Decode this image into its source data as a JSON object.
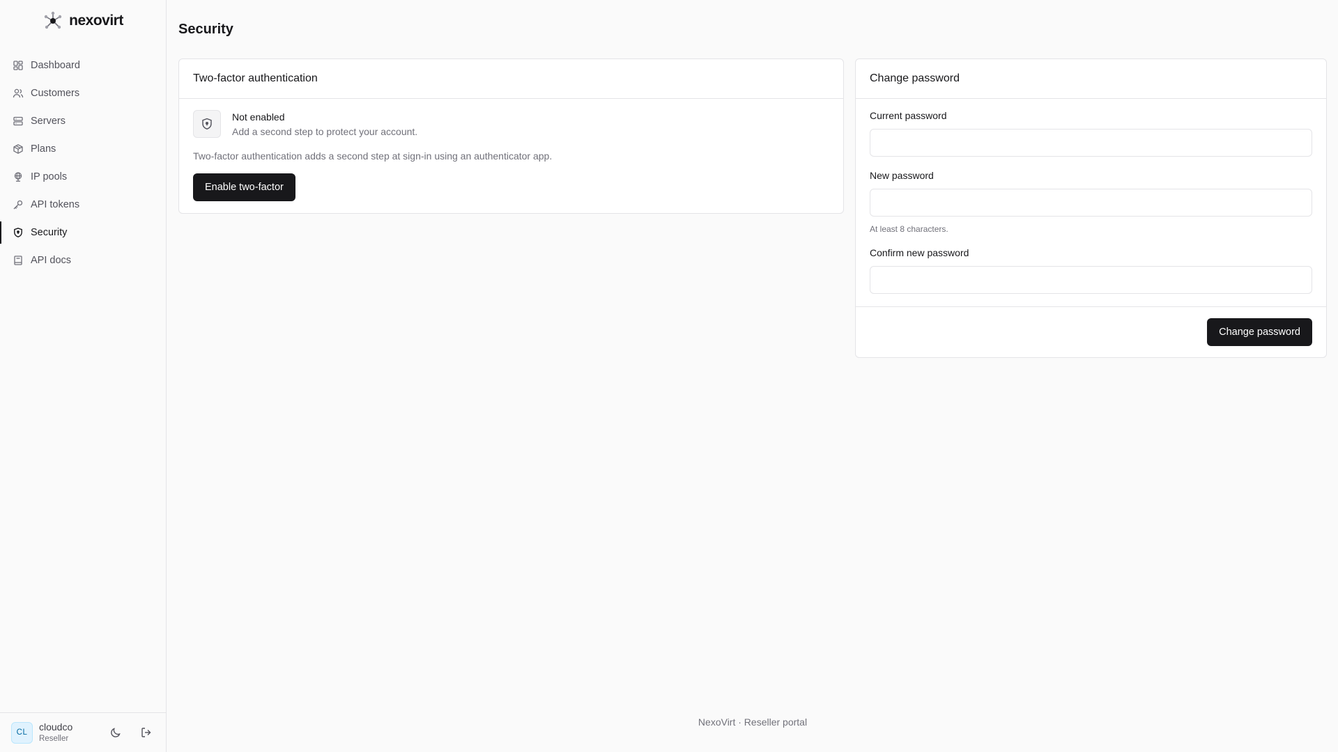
{
  "brand": {
    "name": "nexovirt"
  },
  "nav": {
    "items": [
      {
        "label": "Dashboard",
        "icon": "dashboard-icon"
      },
      {
        "label": "Customers",
        "icon": "users-icon"
      },
      {
        "label": "Servers",
        "icon": "server-icon"
      },
      {
        "label": "Plans",
        "icon": "package-icon"
      },
      {
        "label": "IP pools",
        "icon": "globe-icon"
      },
      {
        "label": "API tokens",
        "icon": "key-icon"
      },
      {
        "label": "Security",
        "icon": "shield-icon",
        "active": true
      },
      {
        "label": "API docs",
        "icon": "book-icon"
      }
    ]
  },
  "user": {
    "initials": "CL",
    "name": "cloudco",
    "role": "Reseller"
  },
  "page": {
    "title": "Security"
  },
  "twofa": {
    "title": "Two-factor authentication",
    "status": "Not enabled",
    "status_sub": "Add a second step to protect your account.",
    "description": "Two-factor authentication adds a second step at sign-in using an authenticator app.",
    "button": "Enable two-factor"
  },
  "password": {
    "title": "Change password",
    "current_label": "Current password",
    "current_value": "",
    "new_label": "New password",
    "new_value": "",
    "new_hint": "At least 8 characters.",
    "confirm_label": "Confirm new password",
    "confirm_value": "",
    "button": "Change password"
  },
  "footer": {
    "text": "NexoVirt · Reseller portal"
  },
  "colors": {
    "accent": "#18181b",
    "avatar_bg": "#e0f2fe",
    "avatar_text": "#0369a1"
  }
}
